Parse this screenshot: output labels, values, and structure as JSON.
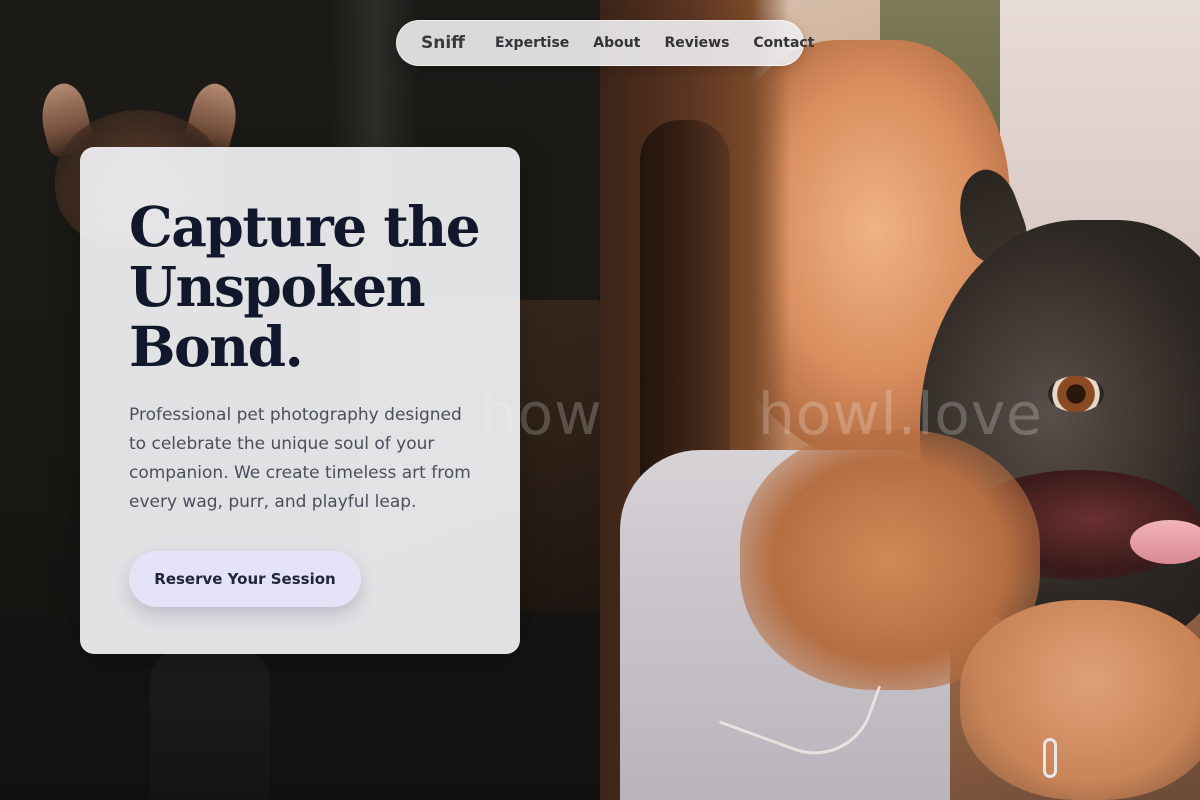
{
  "nav": {
    "brand": "Sniff",
    "links": [
      "Expertise",
      "About",
      "Reviews",
      "Contact"
    ]
  },
  "hero": {
    "headline_lines": [
      "Capture the",
      "Unspoken",
      "Bond."
    ],
    "description": "Professional pet photography designed to celebrate the unique soul of your companion. We create timeless art from every wag, purr, and playful leap.",
    "cta_label": "Reserve Your Session"
  },
  "watermark": {
    "left_text": "howl.",
    "right_text": "howl.love"
  },
  "colors": {
    "card_bg": "#f1f1f4",
    "headline": "#12182b",
    "body_text": "#4a4f5c",
    "cta_bg": "#e5e3f8",
    "nav_bg": "#eceaec"
  }
}
